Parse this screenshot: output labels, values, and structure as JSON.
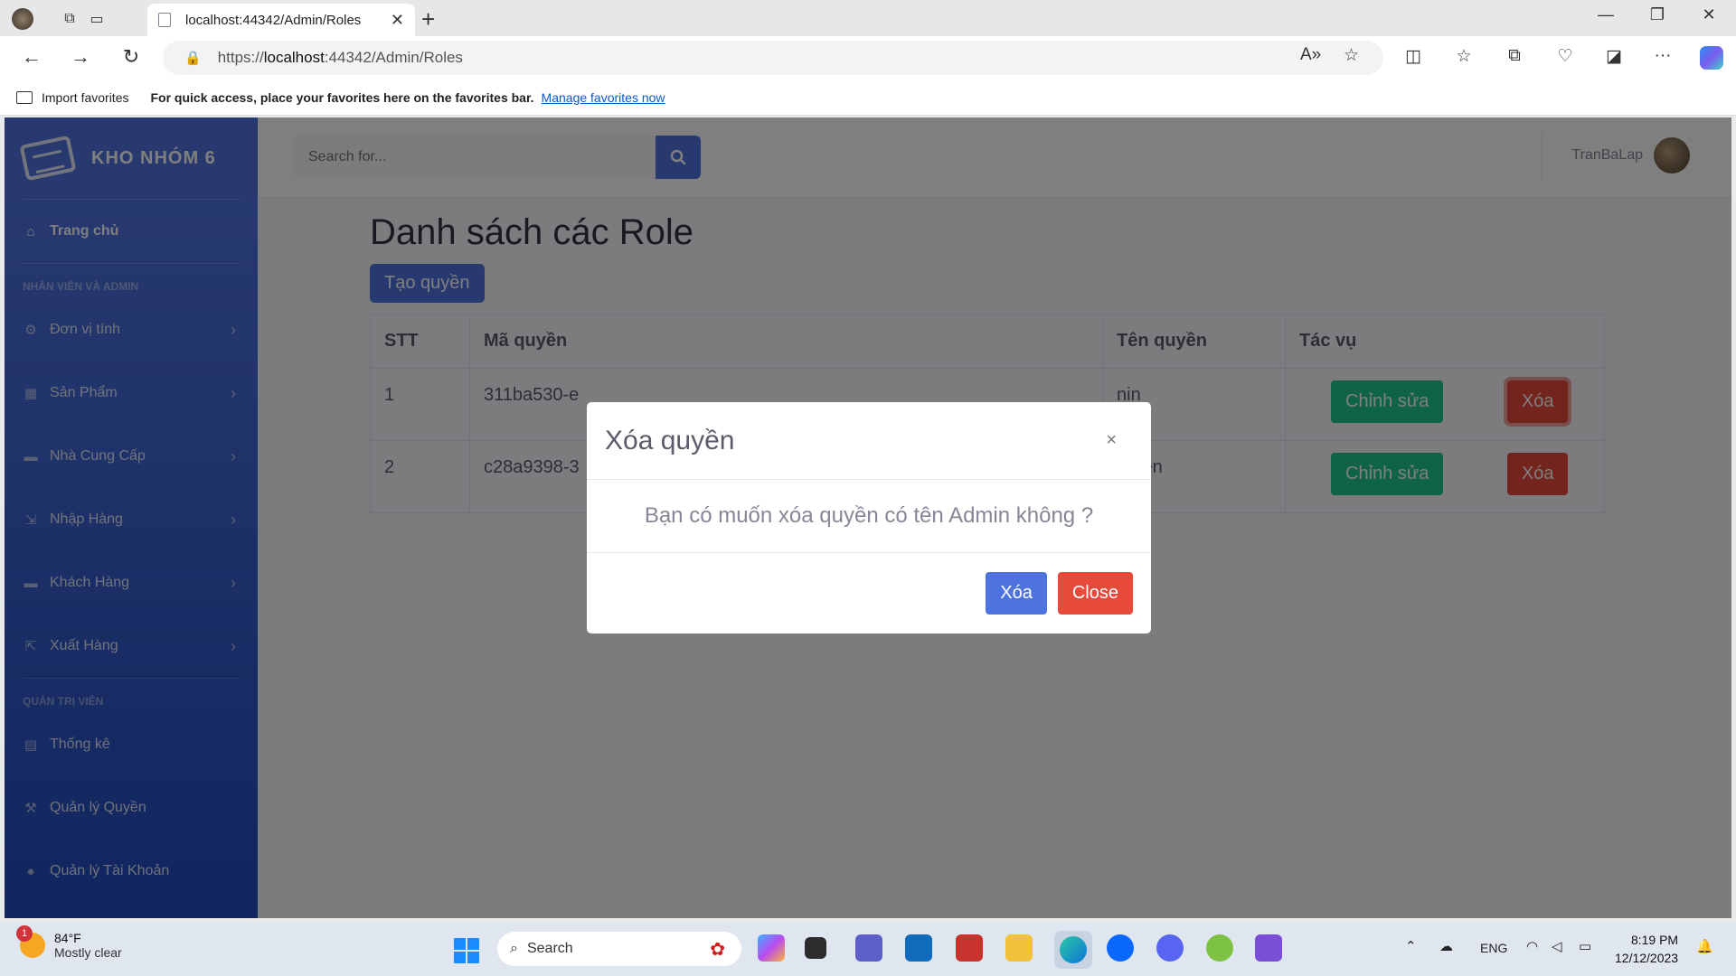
{
  "browser": {
    "tab_title": "localhost:44342/Admin/Roles",
    "url_prefix": "https://",
    "url_host": "localhost",
    "url_rest": ":44342/Admin/Roles",
    "favbar": {
      "import_label": "Import favorites",
      "tip": "For quick access, place your favorites here on the favorites bar.",
      "manage_link": "Manage favorites now"
    }
  },
  "sidebar": {
    "brand": "KHO NHÓM 6",
    "home": "Trang chủ",
    "heading1": "NHÂN VIÊN VÀ ADMIN",
    "items1": [
      {
        "label": "Đơn vị tính",
        "icon": "gear-icon"
      },
      {
        "label": "Sản Phẩm",
        "icon": "dolly-icon"
      },
      {
        "label": "Nhà Cung Cấp",
        "icon": "truck-icon"
      },
      {
        "label": "Nhập Hàng",
        "icon": "import-icon"
      },
      {
        "label": "Khách Hàng",
        "icon": "truck-icon"
      },
      {
        "label": "Xuất Hàng",
        "icon": "export-icon"
      }
    ],
    "heading2": "QUẢN TRỊ VIÊN",
    "items2": [
      {
        "label": "Thống kê",
        "icon": "table-icon"
      },
      {
        "label": "Quản lý Quyền",
        "icon": "hammer-icon"
      },
      {
        "label": "Quản lý Tài Khoản",
        "icon": "user-icon"
      }
    ]
  },
  "topbar": {
    "search_placeholder": "Search for...",
    "username": "TranBaLap"
  },
  "main": {
    "title": "Danh sách các Role",
    "create_button": "Tạo quyền",
    "columns": [
      "STT",
      "Mã quyền",
      "Tên quyền",
      "Tác vụ"
    ],
    "rows": [
      {
        "stt": "1",
        "id": "311ba530-e",
        "name": "nin",
        "edit": "Chỉnh sửa",
        "delete": "Xóa"
      },
      {
        "stt": "2",
        "id": "c28a9398-3",
        "name": "nVien",
        "edit": "Chỉnh sửa",
        "delete": "Xóa"
      }
    ]
  },
  "modal": {
    "title": "Xóa quyền",
    "close_symbol": "×",
    "message": "Bạn có muốn xóa quyền có tên Admin không ?",
    "confirm": "Xóa",
    "close": "Close"
  },
  "taskbar": {
    "weather_badge": "1",
    "temperature": "84°F",
    "condition": "Mostly clear",
    "search_label": "Search",
    "lang": "ENG",
    "time": "8:19 PM",
    "date": "12/12/2023"
  },
  "colors": {
    "primary": "#4e73df",
    "success": "#1cc88a",
    "danger": "#e74a3b"
  }
}
